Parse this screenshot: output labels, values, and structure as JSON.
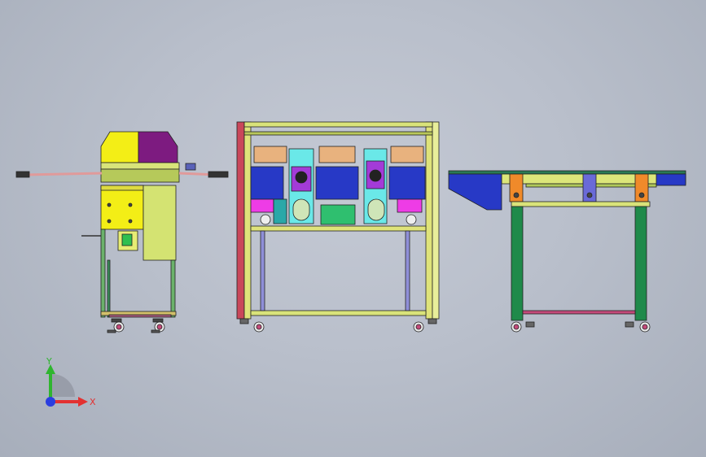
{
  "viewport": {
    "background_top": "#c4c9d4",
    "background_bottom": "#a7aebb"
  },
  "triad": {
    "y_label": "Y",
    "x_label": "X",
    "y_color": "#2fb52f",
    "x_color": "#e33131",
    "z_color": "#2b3ee0"
  },
  "colors": {
    "frame_green": "#1f8a4a",
    "frame_yellow": "#d6e06a",
    "frame_red": "#c9475a",
    "blue_box": "#2739c6",
    "magenta": "#a33bd8",
    "cyan": "#5fe1e1",
    "orange": "#f08a2a",
    "yellow": "#ece820",
    "purple": "#7b1c7d",
    "peach": "#e8b27e"
  },
  "parts": {
    "left_machine": "left-feeder-machine",
    "center_machine": "center-process-station",
    "right_machine": "right-conveyor"
  }
}
